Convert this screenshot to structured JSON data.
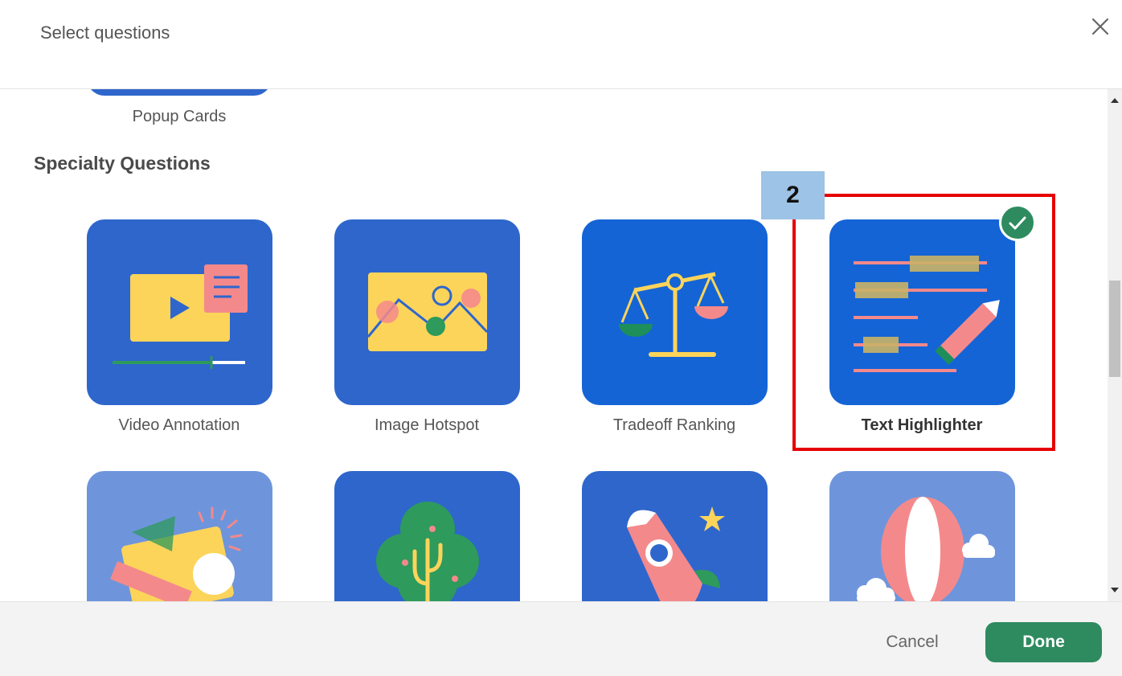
{
  "header": {
    "title": "Select questions",
    "close_icon": "close-icon"
  },
  "previous_section": {
    "last_item_label": "Popup Cards"
  },
  "section": {
    "title": "Specialty Questions",
    "items": [
      {
        "label": "Video Annotation",
        "icon": "video-annotation-icon",
        "selected": false
      },
      {
        "label": "Image Hotspot",
        "icon": "image-hotspot-icon",
        "selected": false
      },
      {
        "label": "Tradeoff Ranking",
        "icon": "scales-icon",
        "selected": false
      },
      {
        "label": "Text Highlighter",
        "icon": "text-highlighter-icon",
        "selected": true
      },
      {
        "label": "",
        "icon": "megaphone-icon",
        "selected": false
      },
      {
        "label": "",
        "icon": "tree-icon",
        "selected": false
      },
      {
        "label": "",
        "icon": "rocket-icon",
        "selected": false
      },
      {
        "label": "",
        "icon": "hot-air-balloon-icon",
        "selected": false
      }
    ]
  },
  "annotation": {
    "step_number": "2"
  },
  "footer": {
    "cancel_label": "Cancel",
    "done_label": "Done"
  },
  "colors": {
    "tile_blue": "#2e66cc",
    "tile_light_blue": "#6e95dc",
    "done_green": "#2e8b5f",
    "annotation_red": "#e60000",
    "annotation_label_bg": "#9dc3e6"
  }
}
